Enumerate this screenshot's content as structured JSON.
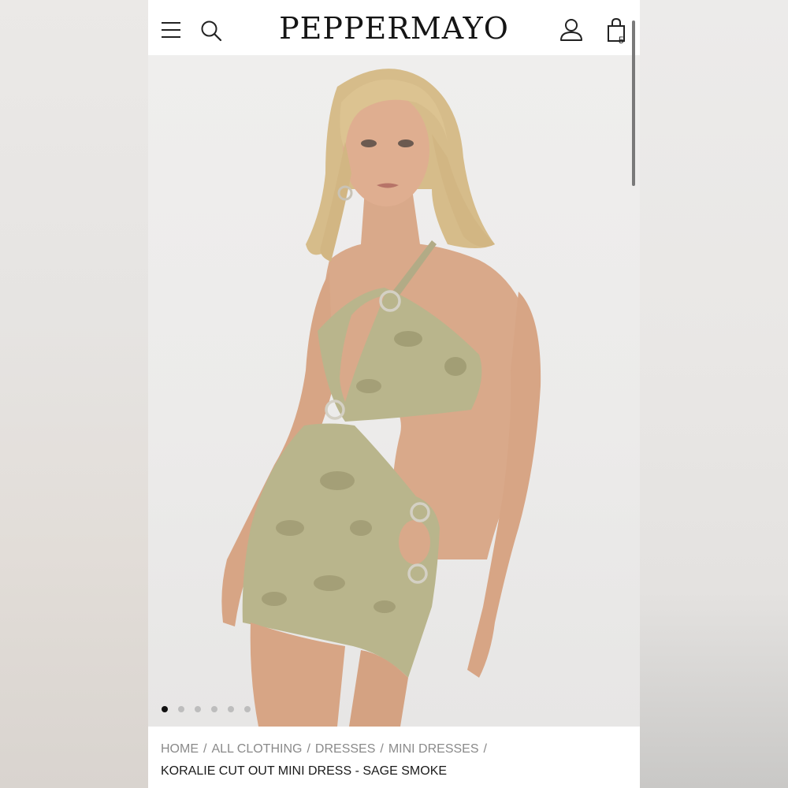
{
  "header": {
    "logo": "PEPPERMAYO",
    "bag_count": "5",
    "icons": [
      "menu-icon",
      "search-icon",
      "account-icon",
      "bag-icon"
    ]
  },
  "gallery": {
    "image_count": 6,
    "active_index": 0
  },
  "breadcrumb": {
    "items": [
      "HOME",
      "ALL CLOTHING",
      "DRESSES",
      "MINI DRESSES"
    ],
    "separator": "/"
  },
  "product": {
    "title": "KORALIE CUT OUT MINI DRESS - SAGE SMOKE"
  },
  "colors": {
    "dress": "#b9b58c",
    "skin": "#d9a98a",
    "hair": "#d8be8c"
  }
}
